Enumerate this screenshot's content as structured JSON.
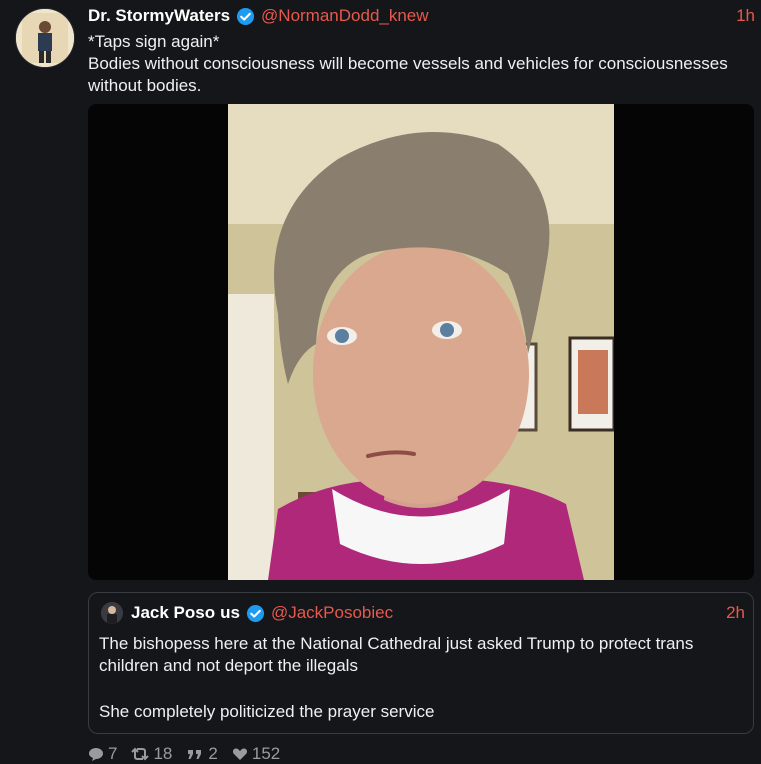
{
  "tweet": {
    "display_name": "Dr. StormyWaters",
    "handle": "@NormanDodd_knew",
    "time": "1h",
    "text_line1": "*Taps sign again*",
    "text_line2": "Bodies without consciousness will become vessels and vehicles for consciousnesses without bodies."
  },
  "quote": {
    "display_name": "Jack Poso",
    "flag": "us",
    "handle": "@JackPosobiec",
    "time": "2h",
    "paragraph1": "The bishopess here at the National Cathedral just asked Trump to protect trans children and not deport the illegals",
    "paragraph2": "She completely politicized the prayer service"
  },
  "stats": {
    "replies": "7",
    "retweets": "18",
    "quotes": "2",
    "likes": "152"
  },
  "colors": {
    "background": "#15161a",
    "accent": "#e8584c",
    "verified": "#1d9bf0"
  },
  "icons": [
    "verified-badge-icon",
    "reply-icon",
    "retweet-icon",
    "quote-icon",
    "like-icon"
  ]
}
